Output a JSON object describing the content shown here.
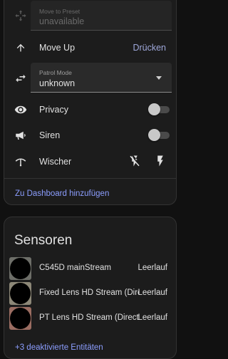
{
  "controls": {
    "preset": {
      "label": "Move to Preset",
      "value": "unavailable"
    },
    "move_up": {
      "label": "Move Up",
      "action": "Drücken"
    },
    "patrol": {
      "label": "Patrol Mode",
      "value": "unknown"
    },
    "privacy": {
      "label": "Privacy",
      "on": false
    },
    "siren": {
      "label": "Siren",
      "on": false
    },
    "wiper": {
      "label": "Wischer"
    },
    "dashboard_link": "Zu Dashboard hinzufügen"
  },
  "sensors": {
    "title": "Sensoren",
    "items": [
      {
        "name": "C545D mainStream",
        "state": "Leerlauf"
      },
      {
        "name": "Fixed Lens HD Stream (Direct)",
        "state": "Leerlauf"
      },
      {
        "name": "PT Lens HD Stream (Direct)",
        "state": "Leerlauf"
      }
    ],
    "more_link": "+3 deaktivierte Entitäten"
  },
  "colors": {
    "background": "#111111",
    "card": "#1c1c1c",
    "accent": "#8c9eff",
    "text": "#e1e1e1"
  }
}
